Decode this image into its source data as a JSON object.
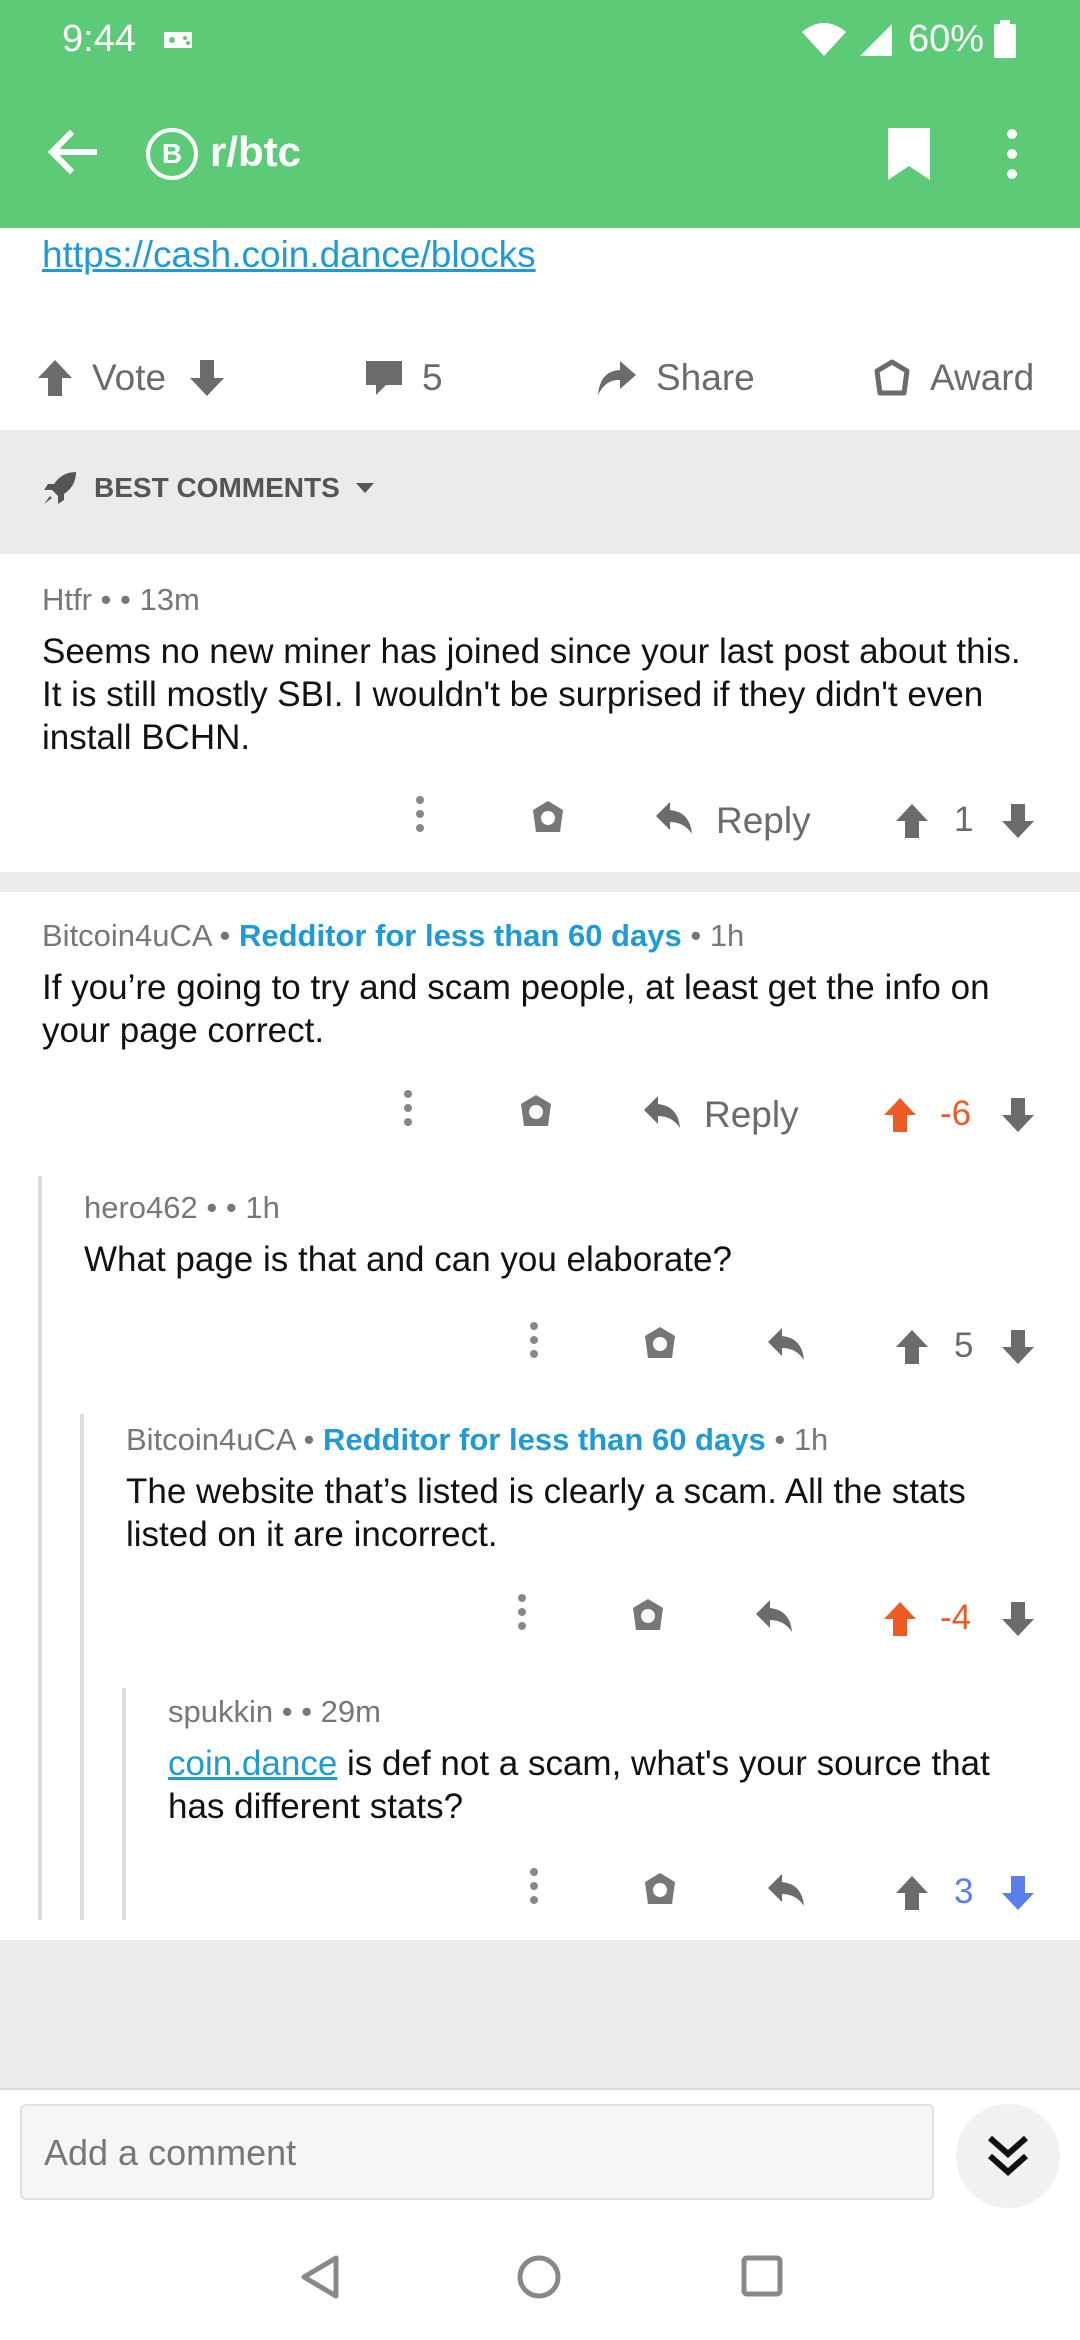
{
  "status_bar": {
    "time": "9:44",
    "battery": "60%"
  },
  "app_bar": {
    "subreddit_icon_letter": "B",
    "subreddit": "r/btc"
  },
  "post": {
    "link_text": "https://cash.coin.dance/blocks"
  },
  "post_actions": {
    "vote": "Vote",
    "comment_count": "5",
    "share": "Share",
    "award": "Award"
  },
  "sort": {
    "label": "BEST COMMENTS"
  },
  "comments": [
    {
      "author": "Htfr",
      "sep1": " • ",
      "flair": "",
      "sep2": " • ",
      "age": "13m",
      "text": "Seems no new miner has joined since your last post about this. It is still mostly SBI. I wouldn't be surprised if they didn't even install BCHN.",
      "reply_label": "Reply",
      "score": "1",
      "vote_state": "none"
    },
    {
      "author": "Bitcoin4uCA",
      "sep1": " • ",
      "flair": "Redditor for less than 60 days",
      "sep2": " • ",
      "age": "1h",
      "text": "If you’re going to try and scam people, at least get the info on your page correct.",
      "reply_label": "Reply",
      "score": "-6",
      "vote_state": "up"
    },
    {
      "author": "hero462",
      "sep1": " • ",
      "flair": "",
      "sep2": " • ",
      "age": "1h",
      "text": "What page is that and can you elaborate?",
      "reply_label": "",
      "score": "5",
      "vote_state": "none"
    },
    {
      "author": "Bitcoin4uCA",
      "sep1": " • ",
      "flair": "Redditor for less than 60 days",
      "sep2": " • ",
      "age": "1h",
      "text": "The website that’s listed is clearly a scam. All the stats listed on it are incorrect.",
      "reply_label": "",
      "score": "-4",
      "vote_state": "up"
    },
    {
      "author": "spukkin",
      "sep1": " • ",
      "flair": "",
      "sep2": " • ",
      "age": "29m",
      "link_text": "coin.dance",
      "text": " is def not a scam, what's your source that has different stats?",
      "reply_label": "",
      "score": "3",
      "vote_state": "down"
    }
  ],
  "composer": {
    "placeholder": "Add a comment"
  },
  "colors": {
    "brand_green": "#5dca78",
    "upvote_orange": "#ee5a24",
    "downvote_blue": "#5b7fe8",
    "link_blue": "#1f9ad6"
  }
}
